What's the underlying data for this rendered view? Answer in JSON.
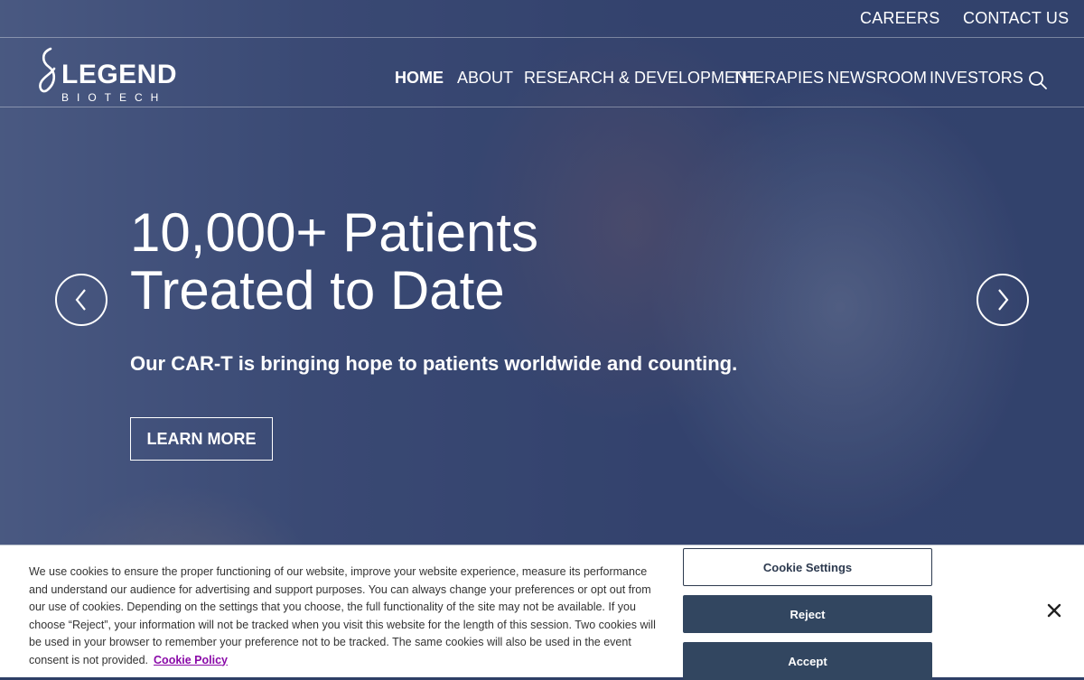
{
  "header": {
    "utility_links": {
      "careers": "CAREERS",
      "contact": "CONTACT US"
    },
    "logo": {
      "wordmark": "LEGEND",
      "subtitle": "BIOTECH"
    },
    "nav": [
      {
        "label": "HOME",
        "active": true
      },
      {
        "label": "ABOUT",
        "active": false
      },
      {
        "label": "RESEARCH & DEVELOPMENT",
        "active": false
      },
      {
        "label": "THERAPIES",
        "active": false
      },
      {
        "label": "NEWSROOM",
        "active": false
      },
      {
        "label": "INVESTORS",
        "active": false
      }
    ],
    "search_icon": "search-icon"
  },
  "hero": {
    "headline_line1": "10,000+ Patients",
    "headline_line2": "Treated to Date",
    "subhead": "Our CAR-T is bringing hope to patients worldwide and counting.",
    "cta_label": "LEARN MORE",
    "prev_icon": "chevron-left-icon",
    "next_icon": "chevron-right-icon"
  },
  "cookie_banner": {
    "text": "We use cookies to ensure the proper functioning of our website, improve your website experience, measure its performance and understand our audience for advertising and support purposes. You can always change your preferences or opt out from our use of cookies. Depending on the settings that you choose, the full functionality of the site may not be available. If you choose “Reject”, your information will not be tracked when you visit this website for the length of this session. Two cookies will be used in your browser to remember your preference not to be tracked. The same cookies will also be used in the event consent is not provided.",
    "policy_link": "Cookie Policy",
    "settings_label": "Cookie Settings",
    "reject_label": "Reject",
    "accept_label": "Accept",
    "close_icon": "close-icon"
  },
  "colors": {
    "nav_text": "#ffffff",
    "button_dark": "#324660",
    "policy_link": "#8a0aa8"
  }
}
